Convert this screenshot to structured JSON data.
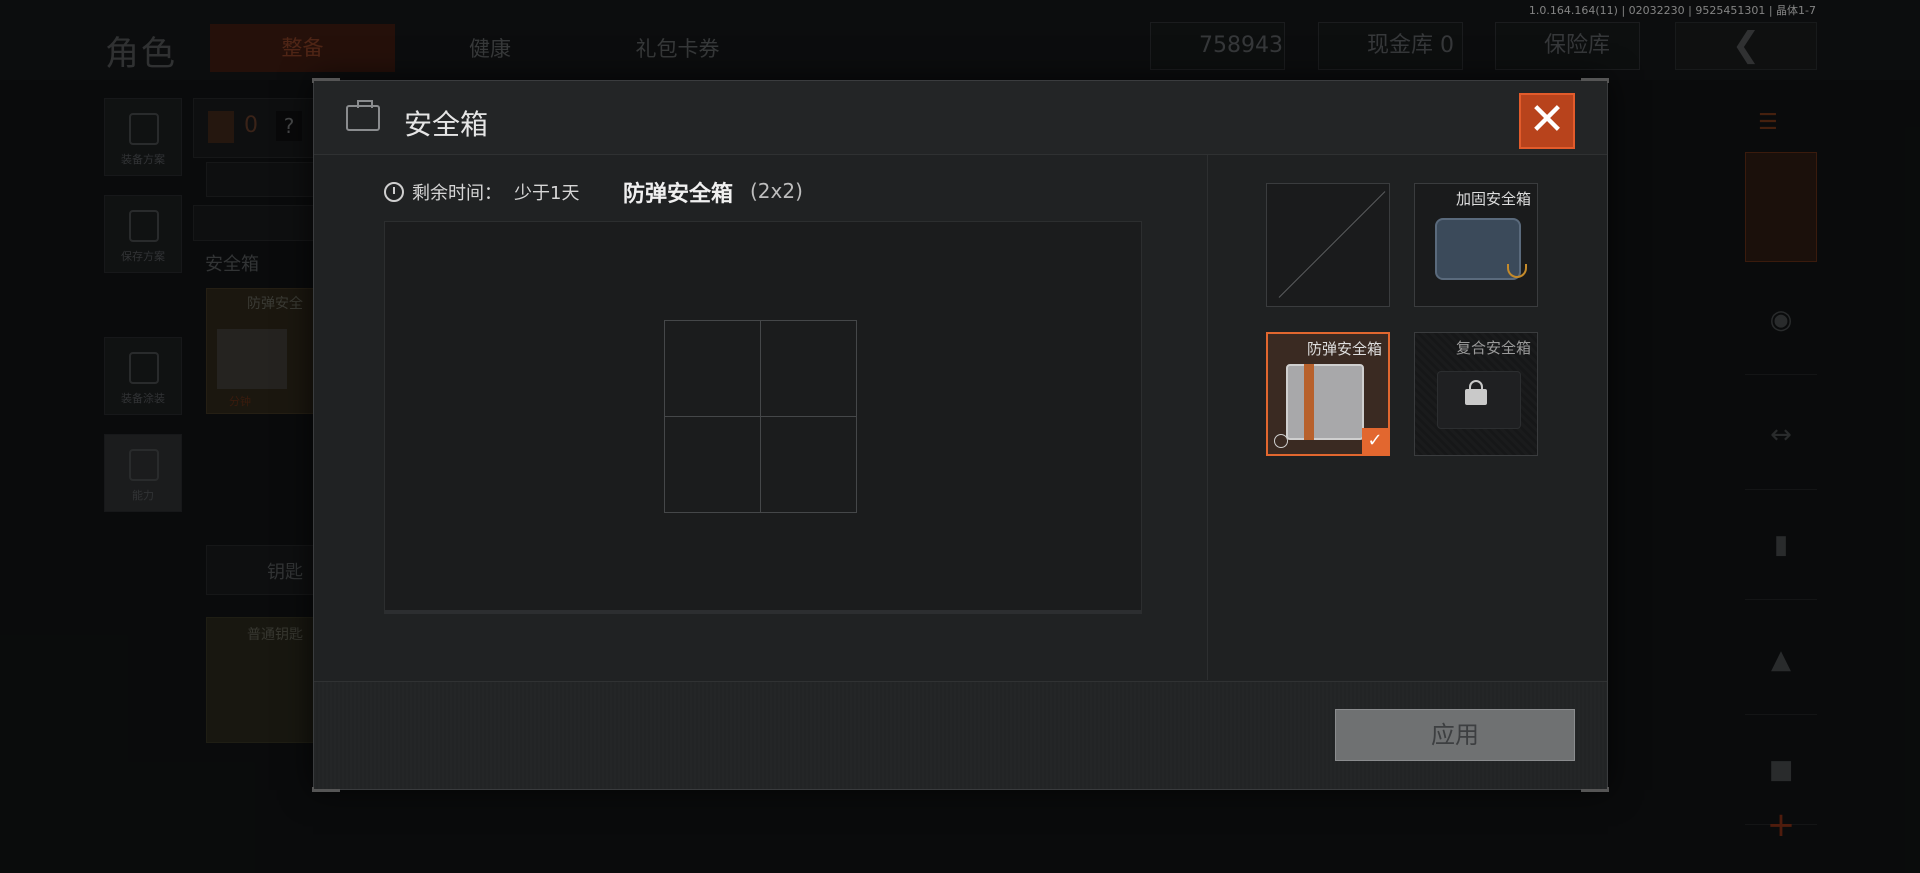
{
  "hud": {
    "version": "1.0.164.164(11) | 02032230 | 9525451301 | 晶体1-7",
    "page_title": "角色",
    "tabs": [
      {
        "label": "整备",
        "active": true
      },
      {
        "label": "健康",
        "active": false
      },
      {
        "label": "礼包卡券",
        "active": false
      }
    ],
    "currency_value": "758943",
    "cash_vault_label": "现金库 0",
    "insurance_label": "保险库",
    "back_icon": "chevron-left-icon"
  },
  "background": {
    "side_buttons": [
      "装备方案",
      "保存方案",
      "装备涂装",
      "能力"
    ],
    "armor_count": "0",
    "question_mark": "?",
    "safebox_section_label": "安全箱",
    "safebox_item_label": "防弹安全",
    "safebox_timer": "分钟",
    "keychain_label": "钥匙",
    "keychain_item_label": "普通钥匙",
    "add_symbol": "+"
  },
  "dialog": {
    "title": "安全箱",
    "close_icon": "close-icon",
    "remaining_label": "剩余时间：",
    "remaining_value": "少于1天",
    "current_case_name": "防弹安全箱",
    "current_case_size": "(2x2)",
    "grid": {
      "cols": 2,
      "rows": 2
    },
    "cases": [
      {
        "name": "",
        "state": "empty"
      },
      {
        "name": "加固安全箱",
        "state": "available"
      },
      {
        "name": "防弹安全箱",
        "state": "selected",
        "timed": true
      },
      {
        "name": "复合安全箱",
        "state": "locked"
      }
    ],
    "apply_label": "应用"
  },
  "colors": {
    "accent": "#e2672f",
    "close_bg": "#b8431c",
    "apply_bg": "#6f7172"
  }
}
